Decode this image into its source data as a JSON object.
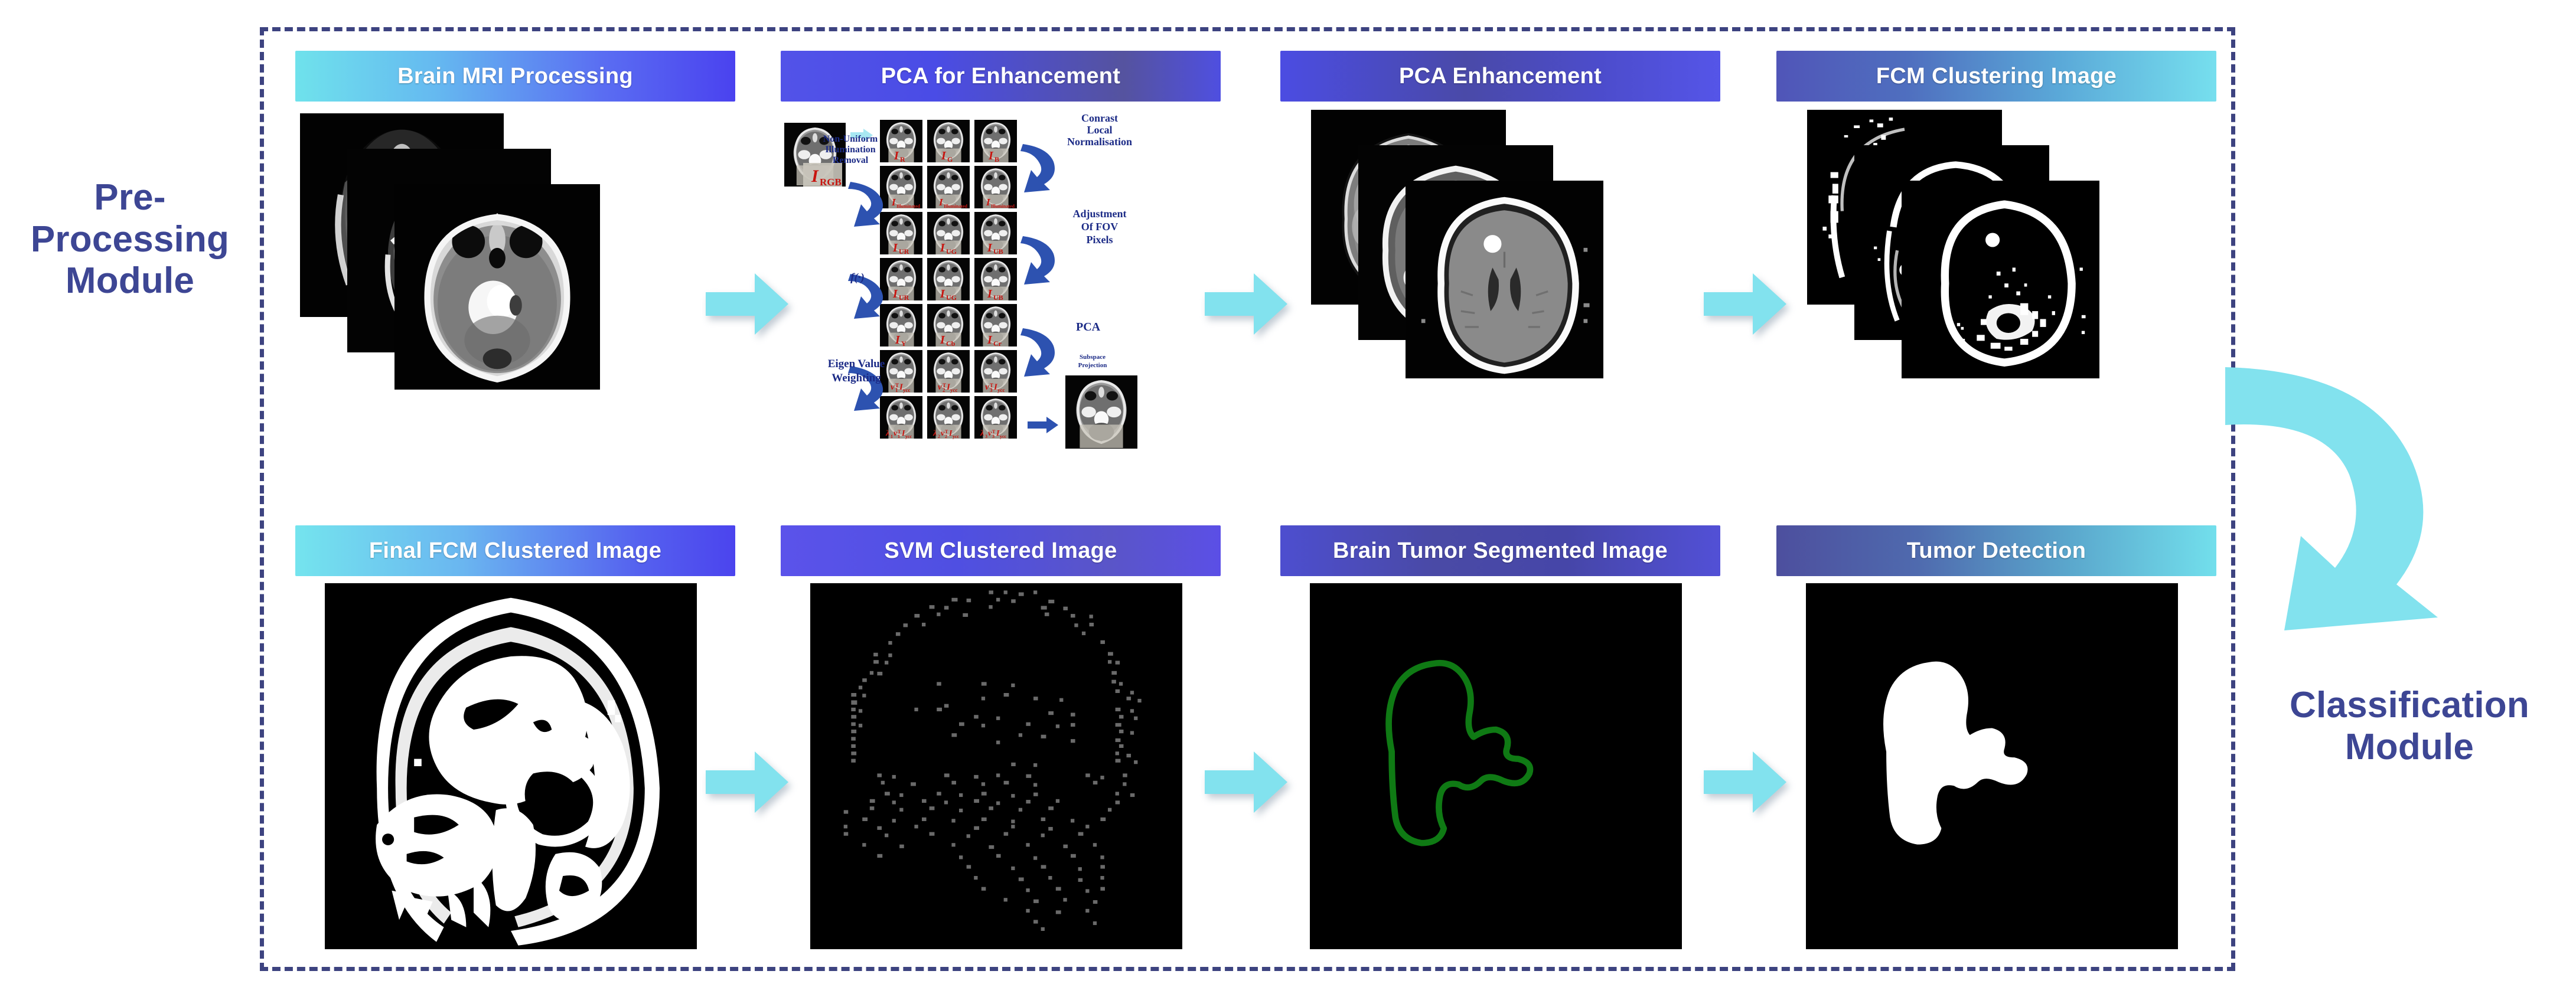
{
  "modules": {
    "pre_processing_label": "Pre-\nProcessing\nModule",
    "classification_label": "Classification\nModule",
    "label_color": "#3d4694",
    "frame_color": "#3d4380"
  },
  "colors": {
    "arrow_cyan": "#82e2ee",
    "banner_text": "#ffffff",
    "tumor_contour_green": "#0f7a14",
    "tumor_fill_white": "#ffffff",
    "pca_arrow_blue": "#2d52b0",
    "pca_label_blue": "#1b2a86",
    "pca_symbol_red": "#c8140f",
    "tile_background": "#000000"
  },
  "top_row": {
    "stages": [
      {
        "id": "brain-mri-processing",
        "title": "Brain MRI Processing",
        "gradient": "g-cyan-blue",
        "content": "mri-slice-stack"
      },
      {
        "id": "pca-for-enhancement",
        "title": "PCA for Enhancement",
        "gradient": "g-blue",
        "content": "pca-diagram"
      },
      {
        "id": "pca-enhancement",
        "title": "PCA Enhancement",
        "gradient": "g-blue-dark",
        "content": "enhanced-slice-stack"
      },
      {
        "id": "fcm-clustering-image",
        "title": "FCM Clustering Image",
        "gradient": "g-blue-cyan",
        "content": "binary-slice-stack"
      }
    ]
  },
  "bottom_row": {
    "stages": [
      {
        "id": "final-fcm-clustered-image",
        "title": "Final FCM Clustered Image",
        "gradient": "g-cyan-blue2",
        "content": "binary-sagittal"
      },
      {
        "id": "svm-clustered-image",
        "title": "SVM Clustered Image",
        "gradient": "g-violet",
        "content": "sparse-dot-head"
      },
      {
        "id": "brain-tumor-segmented-image",
        "title": "Brain Tumor Segmented Image",
        "gradient": "g-indigo",
        "content": "green-contour"
      },
      {
        "id": "tumor-detection",
        "title": "Tumor Detection",
        "gradient": "g-slate-cyan",
        "content": "white-blob"
      }
    ]
  },
  "pca_diagram": {
    "input_label": "I",
    "input_sub": "RGB",
    "step_labels": [
      "Non-Uniform\nIllumination\nRemoval",
      "Conrast\nLocal\nNormalisation",
      "Adjustment\nOf FOV\nPixels",
      "f(·)",
      "PCA",
      "Subspace\nProjection",
      "Eigen Value\nWeighting"
    ],
    "rows": [
      [
        "I_R",
        "I_G",
        "I_B"
      ],
      [
        "I_Illuminated",
        "I_Illuminated",
        "I_Illuminated"
      ],
      [
        "I_UR",
        "I_UG",
        "I_UB"
      ],
      [
        "I_UR",
        "I_UG",
        "I_UB"
      ],
      [
        "I_Y",
        "I_Cb",
        "I_Cr"
      ],
      [
        "v₁ᵀ I_ycc",
        "v₂ᵀ I_ycc",
        "v₃ᵀ I_ycc"
      ],
      [
        "λ₁v₁ᵀ I_ycc",
        "λ₂v₂ᵀ I_ycc",
        "λ₃v₃ᵀ I_ycc"
      ]
    ],
    "output_label": "enhanced-output-slice"
  },
  "flow_arrows": {
    "count_top": 3,
    "count_bottom": 3,
    "return_arrow": "curved-return-arrow"
  }
}
